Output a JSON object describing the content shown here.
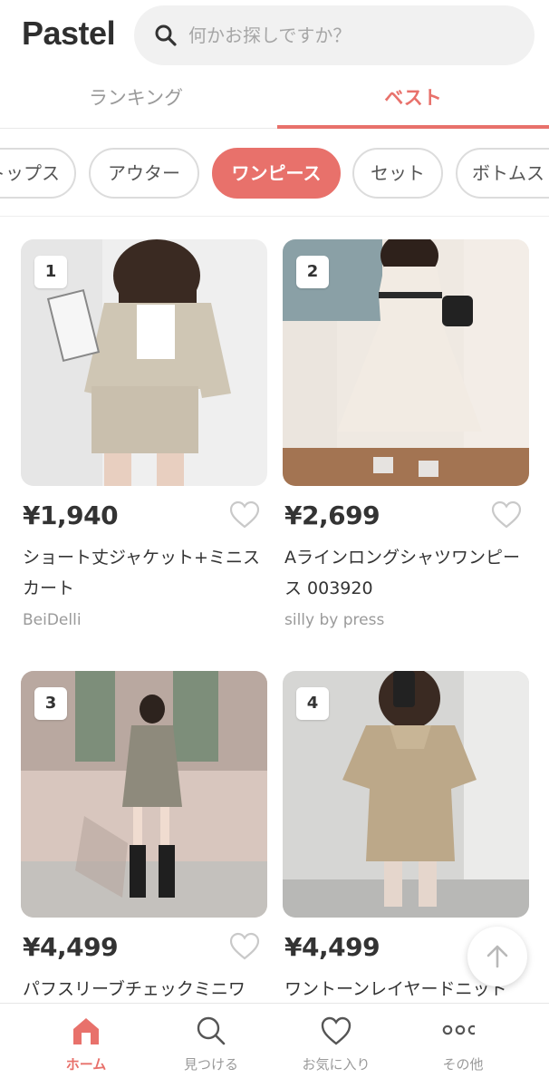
{
  "header": {
    "logo": "Pastel",
    "search_placeholder": "何かお探しですか？"
  },
  "tabs": [
    {
      "label": "ランキング",
      "active": false
    },
    {
      "label": "ベスト",
      "active": true
    }
  ],
  "categories": [
    {
      "label": "トップス",
      "active": false
    },
    {
      "label": "アウター",
      "active": false
    },
    {
      "label": "ワンピース",
      "active": true
    },
    {
      "label": "セット",
      "active": false
    },
    {
      "label": "ボトムス",
      "active": false
    }
  ],
  "products": [
    {
      "rank": "1",
      "price": "¥1,940",
      "title": "ショート丈ジャケット+ミニスカート",
      "shop": "BeiDelli"
    },
    {
      "rank": "2",
      "price": "¥2,699",
      "title": "Aラインロングシャツワンピース 003920",
      "shop": "silly by press"
    },
    {
      "rank": "3",
      "price": "¥4,499",
      "title": "パフスリーブチェックミニワ",
      "shop": ""
    },
    {
      "rank": "4",
      "price": "¥4,499",
      "title": "ワントーンレイヤードニット",
      "shop": ""
    }
  ],
  "bottom_nav": [
    {
      "label": "ホーム",
      "icon": "home-icon",
      "active": true
    },
    {
      "label": "見つける",
      "icon": "search-icon",
      "active": false
    },
    {
      "label": "お気に入り",
      "icon": "heart-icon",
      "active": false
    },
    {
      "label": "その他",
      "icon": "more-icon",
      "active": false
    }
  ],
  "colors": {
    "accent": "#e8716b",
    "muted_text": "#9a9a9a",
    "search_bg": "#f1f1f1"
  }
}
